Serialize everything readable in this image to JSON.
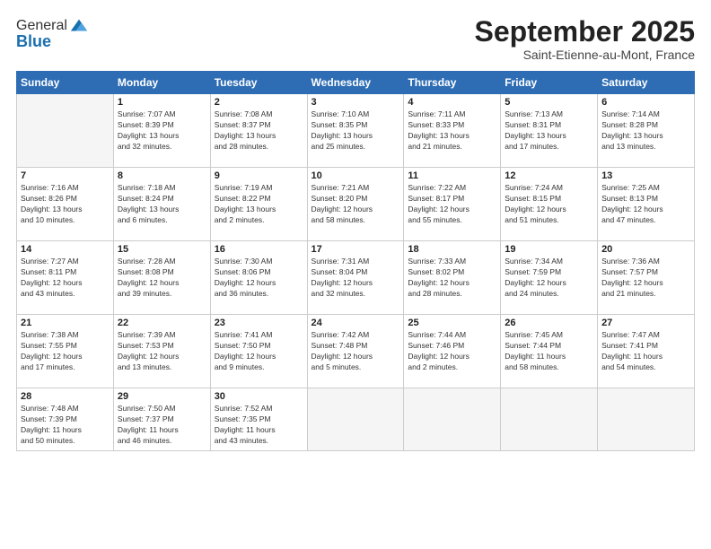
{
  "header": {
    "logo_general": "General",
    "logo_blue": "Blue",
    "month_title": "September 2025",
    "location": "Saint-Etienne-au-Mont, France"
  },
  "days_of_week": [
    "Sunday",
    "Monday",
    "Tuesday",
    "Wednesday",
    "Thursday",
    "Friday",
    "Saturday"
  ],
  "weeks": [
    [
      {
        "day": "",
        "info": ""
      },
      {
        "day": "1",
        "info": "Sunrise: 7:07 AM\nSunset: 8:39 PM\nDaylight: 13 hours\nand 32 minutes."
      },
      {
        "day": "2",
        "info": "Sunrise: 7:08 AM\nSunset: 8:37 PM\nDaylight: 13 hours\nand 28 minutes."
      },
      {
        "day": "3",
        "info": "Sunrise: 7:10 AM\nSunset: 8:35 PM\nDaylight: 13 hours\nand 25 minutes."
      },
      {
        "day": "4",
        "info": "Sunrise: 7:11 AM\nSunset: 8:33 PM\nDaylight: 13 hours\nand 21 minutes."
      },
      {
        "day": "5",
        "info": "Sunrise: 7:13 AM\nSunset: 8:31 PM\nDaylight: 13 hours\nand 17 minutes."
      },
      {
        "day": "6",
        "info": "Sunrise: 7:14 AM\nSunset: 8:28 PM\nDaylight: 13 hours\nand 13 minutes."
      }
    ],
    [
      {
        "day": "7",
        "info": "Sunrise: 7:16 AM\nSunset: 8:26 PM\nDaylight: 13 hours\nand 10 minutes."
      },
      {
        "day": "8",
        "info": "Sunrise: 7:18 AM\nSunset: 8:24 PM\nDaylight: 13 hours\nand 6 minutes."
      },
      {
        "day": "9",
        "info": "Sunrise: 7:19 AM\nSunset: 8:22 PM\nDaylight: 13 hours\nand 2 minutes."
      },
      {
        "day": "10",
        "info": "Sunrise: 7:21 AM\nSunset: 8:20 PM\nDaylight: 12 hours\nand 58 minutes."
      },
      {
        "day": "11",
        "info": "Sunrise: 7:22 AM\nSunset: 8:17 PM\nDaylight: 12 hours\nand 55 minutes."
      },
      {
        "day": "12",
        "info": "Sunrise: 7:24 AM\nSunset: 8:15 PM\nDaylight: 12 hours\nand 51 minutes."
      },
      {
        "day": "13",
        "info": "Sunrise: 7:25 AM\nSunset: 8:13 PM\nDaylight: 12 hours\nand 47 minutes."
      }
    ],
    [
      {
        "day": "14",
        "info": "Sunrise: 7:27 AM\nSunset: 8:11 PM\nDaylight: 12 hours\nand 43 minutes."
      },
      {
        "day": "15",
        "info": "Sunrise: 7:28 AM\nSunset: 8:08 PM\nDaylight: 12 hours\nand 39 minutes."
      },
      {
        "day": "16",
        "info": "Sunrise: 7:30 AM\nSunset: 8:06 PM\nDaylight: 12 hours\nand 36 minutes."
      },
      {
        "day": "17",
        "info": "Sunrise: 7:31 AM\nSunset: 8:04 PM\nDaylight: 12 hours\nand 32 minutes."
      },
      {
        "day": "18",
        "info": "Sunrise: 7:33 AM\nSunset: 8:02 PM\nDaylight: 12 hours\nand 28 minutes."
      },
      {
        "day": "19",
        "info": "Sunrise: 7:34 AM\nSunset: 7:59 PM\nDaylight: 12 hours\nand 24 minutes."
      },
      {
        "day": "20",
        "info": "Sunrise: 7:36 AM\nSunset: 7:57 PM\nDaylight: 12 hours\nand 21 minutes."
      }
    ],
    [
      {
        "day": "21",
        "info": "Sunrise: 7:38 AM\nSunset: 7:55 PM\nDaylight: 12 hours\nand 17 minutes."
      },
      {
        "day": "22",
        "info": "Sunrise: 7:39 AM\nSunset: 7:53 PM\nDaylight: 12 hours\nand 13 minutes."
      },
      {
        "day": "23",
        "info": "Sunrise: 7:41 AM\nSunset: 7:50 PM\nDaylight: 12 hours\nand 9 minutes."
      },
      {
        "day": "24",
        "info": "Sunrise: 7:42 AM\nSunset: 7:48 PM\nDaylight: 12 hours\nand 5 minutes."
      },
      {
        "day": "25",
        "info": "Sunrise: 7:44 AM\nSunset: 7:46 PM\nDaylight: 12 hours\nand 2 minutes."
      },
      {
        "day": "26",
        "info": "Sunrise: 7:45 AM\nSunset: 7:44 PM\nDaylight: 11 hours\nand 58 minutes."
      },
      {
        "day": "27",
        "info": "Sunrise: 7:47 AM\nSunset: 7:41 PM\nDaylight: 11 hours\nand 54 minutes."
      }
    ],
    [
      {
        "day": "28",
        "info": "Sunrise: 7:48 AM\nSunset: 7:39 PM\nDaylight: 11 hours\nand 50 minutes."
      },
      {
        "day": "29",
        "info": "Sunrise: 7:50 AM\nSunset: 7:37 PM\nDaylight: 11 hours\nand 46 minutes."
      },
      {
        "day": "30",
        "info": "Sunrise: 7:52 AM\nSunset: 7:35 PM\nDaylight: 11 hours\nand 43 minutes."
      },
      {
        "day": "",
        "info": ""
      },
      {
        "day": "",
        "info": ""
      },
      {
        "day": "",
        "info": ""
      },
      {
        "day": "",
        "info": ""
      }
    ]
  ]
}
